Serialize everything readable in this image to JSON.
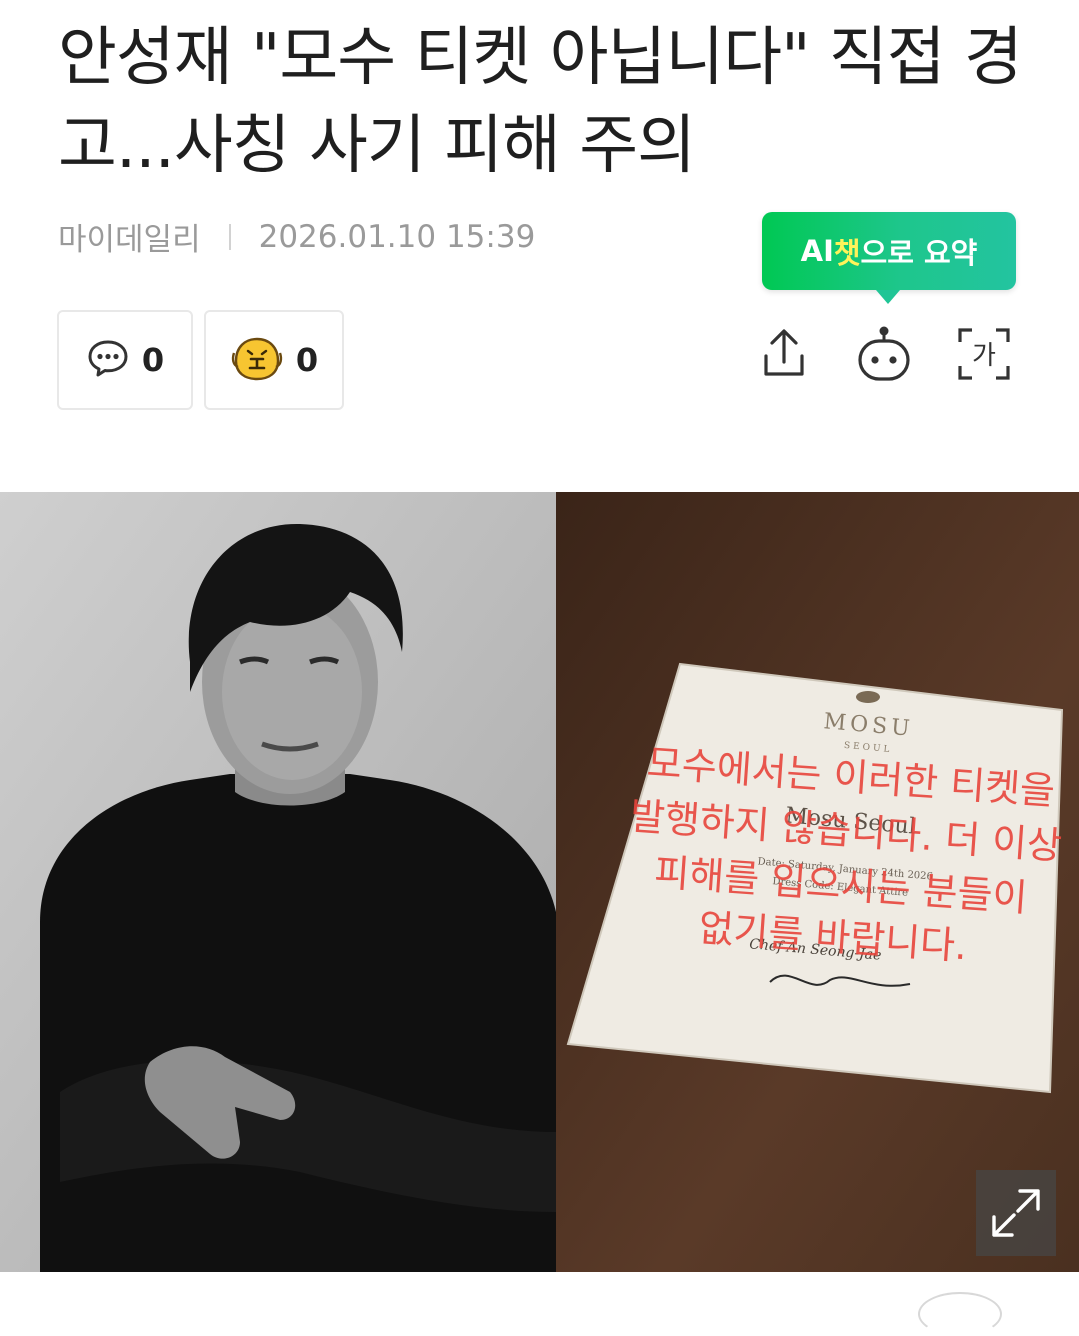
{
  "article": {
    "title": "안성재 \"모수 티켓 아닙니다\" 직접 경고...사칭 사기 피해 주의",
    "source": "마이데일리",
    "datetime": "2026.01.10 15:39"
  },
  "ai_summary": {
    "part1": "AI",
    "part2": "챗",
    "part3": "으로 요약"
  },
  "reactions": {
    "comments": {
      "icon": "chat-bubble-icon",
      "count": "0"
    },
    "emotion": {
      "icon": "face-reaction-icon",
      "count": "0"
    }
  },
  "tools": {
    "share_icon": "share-icon",
    "bot_icon": "chatbot-icon",
    "font_icon": "font-size-icon",
    "font_glyph": "가"
  },
  "photo": {
    "card_brand": "MOSU",
    "card_sub": "SEOUL",
    "card_greeting": "Mosu Seoul",
    "card_date": "Date: Saturday, January 24th 2026",
    "card_dress": "Dress Code: Elegant Attire",
    "card_chef": "Chef An Seong-Jae",
    "overlay_lines": [
      "모수에서는 이러한 티켓을",
      "발행하지 않습니다. 더 이상",
      "피해를 입으시는 분들이",
      "없기를 바랍니다."
    ],
    "expand_icon": "expand-icon"
  },
  "colors": {
    "ai_green": "#00c853",
    "overlay_red": "#e8453c",
    "emoji_yellow": "#f7c531"
  }
}
